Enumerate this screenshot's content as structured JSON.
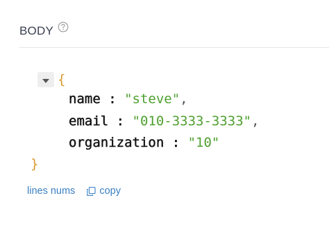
{
  "section": {
    "title": "BODY",
    "help_icon": "question-circle-icon"
  },
  "json_body": {
    "open_brace": "{",
    "close_brace": "}",
    "toggle_icon": "caret-down-icon",
    "properties": [
      {
        "key": "name",
        "colon": " : ",
        "value": "\"steve\"",
        "comma": ","
      },
      {
        "key": "email",
        "colon": " : ",
        "value": "\"010-3333-3333\"",
        "comma": ","
      },
      {
        "key": "organization",
        "colon": " : ",
        "value": "\"10\"",
        "comma": ""
      }
    ]
  },
  "actions": {
    "lines_nums_label": "lines nums",
    "copy_label": "copy",
    "copy_icon": "copy-icon"
  },
  "colors": {
    "text": "#3b4151",
    "link": "#3a7fc4",
    "string_value": "#4ea02f",
    "brace": "#d99a2b",
    "divider": "#e6e6e6"
  }
}
